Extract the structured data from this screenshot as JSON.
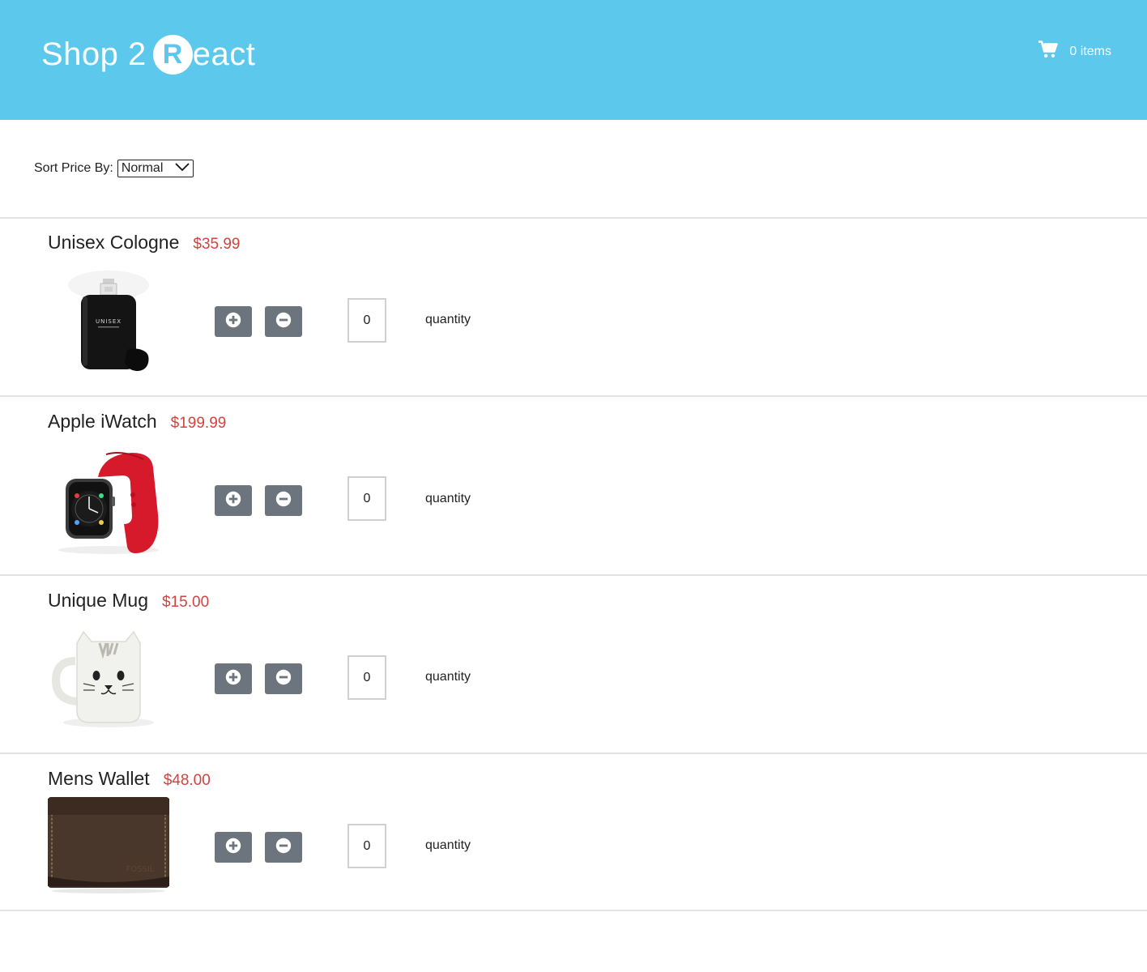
{
  "header": {
    "logo_prefix": "Shop 2 ",
    "logo_r": "R",
    "logo_suffix": "eact",
    "cart_count_label": "0 items",
    "bg_color": "#5bc8ec"
  },
  "sort": {
    "label": "Sort Price By:",
    "selected": "Normal"
  },
  "products": [
    {
      "name": "Unisex Cologne",
      "price": "$35.99",
      "quantity": "0",
      "quantity_label": "quantity",
      "image": "cologne"
    },
    {
      "name": "Apple iWatch",
      "price": "$199.99",
      "quantity": "0",
      "quantity_label": "quantity",
      "image": "watch"
    },
    {
      "name": "Unique Mug",
      "price": "$15.00",
      "quantity": "0",
      "quantity_label": "quantity",
      "image": "mug"
    },
    {
      "name": "Mens Wallet",
      "price": "$48.00",
      "quantity": "0",
      "quantity_label": "quantity",
      "image": "wallet"
    }
  ],
  "icons": {
    "cart": "shopping-cart-icon",
    "increment": "plus-circle-icon",
    "decrement": "minus-circle-icon",
    "dropdown": "chevron-down-icon"
  },
  "colors": {
    "price": "#d1433f",
    "button": "#6c757d"
  }
}
